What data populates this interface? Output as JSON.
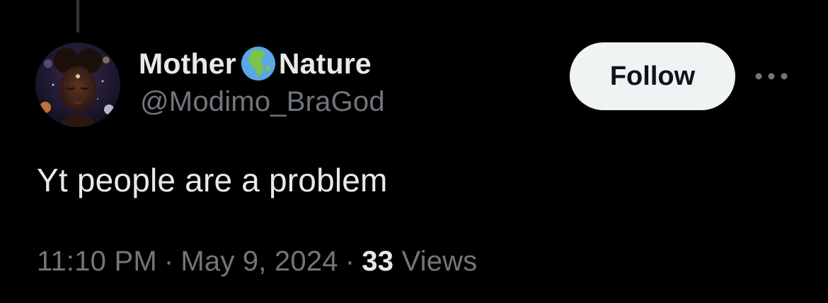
{
  "author": {
    "name_first": "Mother",
    "name_second": "Nature",
    "name_emoji_icon": "globe-earth-africa-icon",
    "handle": "@Modimo_BraGod"
  },
  "actions": {
    "follow_label": "Follow",
    "more_icon": "more-horizontal-icon"
  },
  "tweet": {
    "text": "Yt people are a problem"
  },
  "meta": {
    "time": "11:10 PM",
    "separator": "·",
    "date": "May 9, 2024",
    "views_count": "33",
    "views_label": "Views"
  },
  "colors": {
    "background": "#000000",
    "primary_text": "#e7e9ea",
    "secondary_text": "#71767b",
    "follow_bg": "#eff3f4",
    "follow_text": "#0f1419",
    "thread_line": "#333639"
  }
}
